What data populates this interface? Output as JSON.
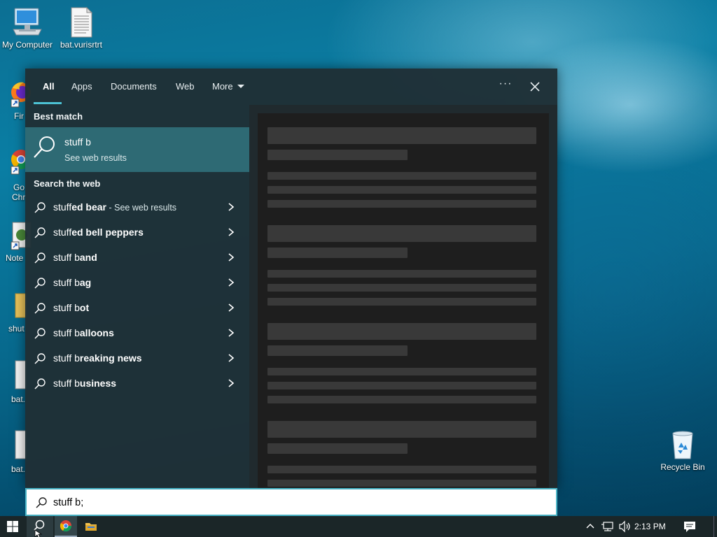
{
  "desktop": {
    "icons": [
      {
        "label": "My Computer"
      },
      {
        "label": "bat.vurisrtrt"
      },
      {
        "label": "Recycle Bin"
      }
    ],
    "partial_labels": [
      "Fir",
      "Go",
      "Chr",
      "Note",
      "shut",
      "bat.",
      "bat."
    ]
  },
  "search_panel": {
    "tabs": [
      {
        "label": "All",
        "active": true
      },
      {
        "label": "Apps"
      },
      {
        "label": "Documents"
      },
      {
        "label": "Web"
      },
      {
        "label": "More"
      }
    ],
    "options_label": "···",
    "best_match_heading": "Best match",
    "best_match": {
      "title": "stuff b",
      "subtitle": "See web results"
    },
    "search_web_heading": "Search the web",
    "suggestions": [
      {
        "prefix": "stuff",
        "completion": "ed bear",
        "note": " - See web results"
      },
      {
        "prefix": "stuff",
        "completion": "ed bell peppers"
      },
      {
        "prefix": "stuff b",
        "completion": "and"
      },
      {
        "prefix": "stuff b",
        "completion": "ag"
      },
      {
        "prefix": "stuff b",
        "completion": "ot"
      },
      {
        "prefix": "stuff b",
        "completion": "alloons"
      },
      {
        "prefix": "stuff b",
        "completion": "reaking news"
      },
      {
        "prefix": "stuff b",
        "completion": "usiness"
      }
    ]
  },
  "search_box": {
    "value": "stuff b;"
  },
  "taskbar": {
    "clock": "2:13 PM"
  },
  "colors": {
    "accent": "#4cc2d4",
    "selected_row": "#2e6a74",
    "panel": "#1f2f36",
    "taskbar": "#1b2628"
  }
}
